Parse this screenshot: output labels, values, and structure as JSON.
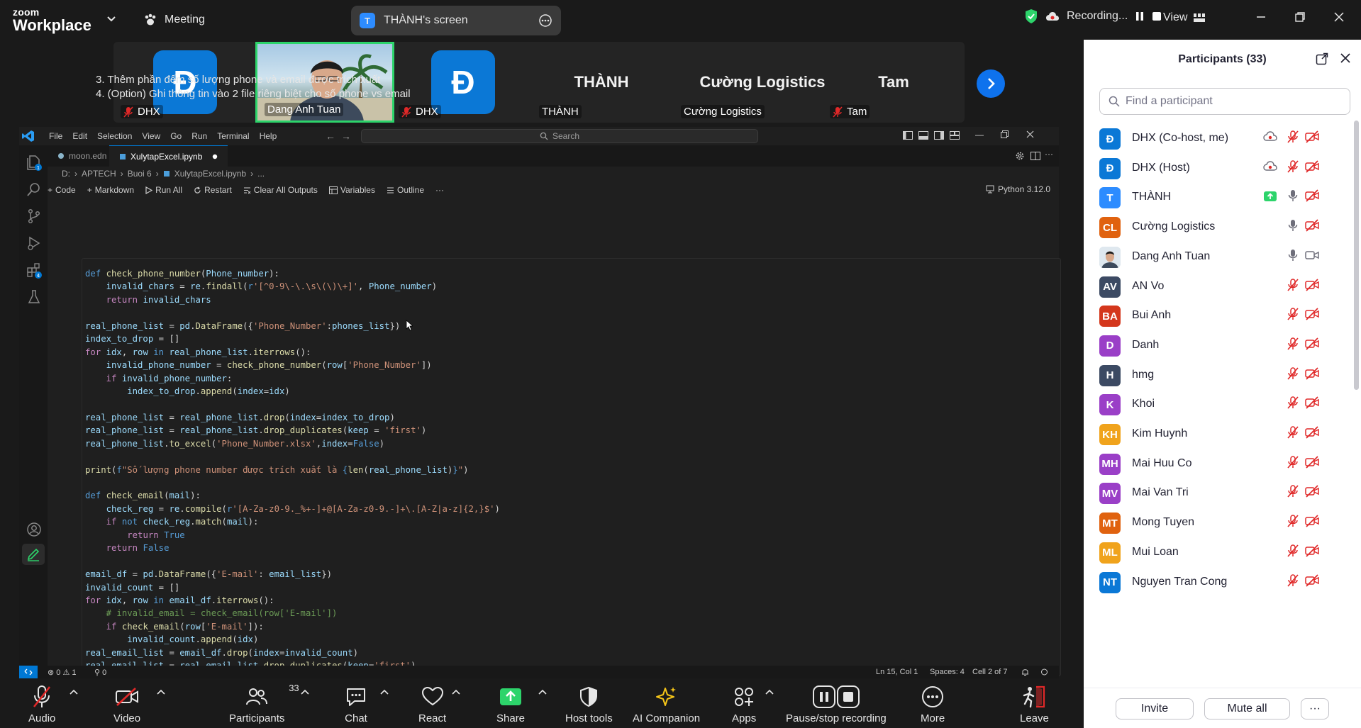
{
  "topbar": {
    "logo_line1": "zoom",
    "logo_line2": "Workplace",
    "meeting_label": "Meeting",
    "screen_badge": "T",
    "screen_label": "THÀNH's screen",
    "recording_label": "Recording...",
    "view_label": "View"
  },
  "gallery": {
    "tiles": [
      {
        "avatar": "Đ",
        "bigname": "",
        "label": "DHX",
        "muted": true
      },
      {
        "avatar": "",
        "bigname": "",
        "label": "Dang Anh Tuan",
        "muted": false,
        "video": true
      },
      {
        "avatar": "Đ",
        "bigname": "",
        "label": "DHX",
        "muted": true
      },
      {
        "avatar": "",
        "bigname": "THÀNH",
        "label": "THÀNH",
        "muted": false
      },
      {
        "avatar": "",
        "bigname": "Cường Logistics",
        "label": "Cường Logistics",
        "muted": false
      },
      {
        "avatar": "",
        "bigname": "Tam",
        "label": "Tam",
        "muted": true
      }
    ]
  },
  "vscode": {
    "menu": [
      "File",
      "Edit",
      "Selection",
      "View",
      "Go",
      "Run",
      "Terminal",
      "Help"
    ],
    "search_placeholder": "Search",
    "tabs": [
      {
        "label": "moon.edn",
        "active": false
      },
      {
        "label": "XulytapExcel.ipynb",
        "active": true
      }
    ],
    "breadcrumb": [
      "D:",
      "APTECH",
      "Buoi 6",
      "XulytapExcel.ipynb",
      "..."
    ],
    "toolbar": {
      "code": "Code",
      "markdown": "Markdown",
      "run_all": "Run All",
      "restart": "Restart",
      "clear": "Clear All Outputs",
      "variables": "Variables",
      "outline": "Outline",
      "more": "···",
      "kernel": "Python 3.12.0"
    },
    "markdown_lines": [
      "3. Thêm phần đếm số lượng phone và email được trích xuất",
      "4. (Option) Ghi thông tin vào 2 file riêng biệt cho số phone vs email"
    ],
    "code_lines": [
      [
        [
          "kw",
          "def "
        ],
        [
          "fn",
          "check_phone_number"
        ],
        [
          "",
          "("
        ],
        [
          "vr",
          "Phone_number"
        ],
        [
          "",
          "):"
        ]
      ],
      [
        [
          "",
          "    "
        ],
        [
          "vr",
          "invalid_chars"
        ],
        [
          "",
          " = "
        ],
        [
          "vr",
          "re"
        ],
        [
          "",
          "."
        ],
        [
          "fn",
          "findall"
        ],
        [
          "",
          "("
        ],
        [
          "kw",
          "r"
        ],
        [
          "st",
          "'[^0-9\\-\\.\\s\\(\\)\\+]'"
        ],
        [
          "",
          ", "
        ],
        [
          "vr",
          "Phone_number"
        ],
        [
          "",
          ")"
        ]
      ],
      [
        [
          "",
          "    "
        ],
        [
          "ct",
          "return "
        ],
        [
          "vr",
          "invalid_chars"
        ]
      ],
      [
        [
          "",
          ""
        ]
      ],
      [
        [
          "vr",
          "real_phone_list"
        ],
        [
          "",
          " = "
        ],
        [
          "vr",
          "pd"
        ],
        [
          "",
          "."
        ],
        [
          "fn",
          "DataFrame"
        ],
        [
          "",
          "({"
        ],
        [
          "st",
          "'Phone_Number'"
        ],
        [
          "",
          ":"
        ],
        [
          "vr",
          "phones_list"
        ],
        [
          "",
          "})"
        ]
      ],
      [
        [
          "vr",
          "index_to_drop"
        ],
        [
          "",
          " = []"
        ]
      ],
      [
        [
          "ct",
          "for "
        ],
        [
          "vr",
          "idx"
        ],
        [
          "",
          ", "
        ],
        [
          "vr",
          "row"
        ],
        [
          "kw",
          " in "
        ],
        [
          "vr",
          "real_phone_list"
        ],
        [
          "",
          "."
        ],
        [
          "fn",
          "iterrows"
        ],
        [
          "",
          "():"
        ]
      ],
      [
        [
          "",
          "    "
        ],
        [
          "vr",
          "invalid_phone_number"
        ],
        [
          "",
          " = "
        ],
        [
          "fn",
          "check_phone_number"
        ],
        [
          "",
          "("
        ],
        [
          "vr",
          "row"
        ],
        [
          "",
          "["
        ],
        [
          "st",
          "'Phone_Number'"
        ],
        [
          "",
          "])"
        ]
      ],
      [
        [
          "",
          "    "
        ],
        [
          "ct",
          "if "
        ],
        [
          "vr",
          "invalid_phone_number"
        ],
        [
          "",
          ":"
        ]
      ],
      [
        [
          "",
          "        "
        ],
        [
          "vr",
          "index_to_drop"
        ],
        [
          "",
          "."
        ],
        [
          "fn",
          "append"
        ],
        [
          "",
          "("
        ],
        [
          "vr",
          "index"
        ],
        [
          "",
          "="
        ],
        [
          "vr",
          "idx"
        ],
        [
          "",
          ")"
        ]
      ],
      [
        [
          "",
          ""
        ]
      ],
      [
        [
          "vr",
          "real_phone_list"
        ],
        [
          "",
          " = "
        ],
        [
          "vr",
          "real_phone_list"
        ],
        [
          "",
          "."
        ],
        [
          "fn",
          "drop"
        ],
        [
          "",
          "("
        ],
        [
          "vr",
          "index"
        ],
        [
          "",
          "="
        ],
        [
          "vr",
          "index_to_drop"
        ],
        [
          "",
          ")"
        ]
      ],
      [
        [
          "vr",
          "real_phone_list"
        ],
        [
          "",
          " = "
        ],
        [
          "vr",
          "real_phone_list"
        ],
        [
          "",
          "."
        ],
        [
          "fn",
          "drop_duplicates"
        ],
        [
          "",
          "("
        ],
        [
          "vr",
          "keep"
        ],
        [
          "",
          " = "
        ],
        [
          "st",
          "'first'"
        ],
        [
          "",
          ")"
        ]
      ],
      [
        [
          "vr",
          "real_phone_list"
        ],
        [
          "",
          "."
        ],
        [
          "fn",
          "to_excel"
        ],
        [
          "",
          "("
        ],
        [
          "st",
          "'Phone_Number.xlsx'"
        ],
        [
          "",
          ","
        ],
        [
          "vr",
          "index"
        ],
        [
          "",
          "="
        ],
        [
          "kw",
          "False"
        ],
        [
          "",
          ")"
        ]
      ],
      [
        [
          "",
          ""
        ]
      ],
      [
        [
          "fn",
          "print"
        ],
        [
          "",
          "("
        ],
        [
          "kw",
          "f"
        ],
        [
          "st",
          "\"Số lượng phone number được trích xuất là "
        ],
        [
          "kw",
          "{"
        ],
        [
          "fn",
          "len"
        ],
        [
          "",
          "("
        ],
        [
          "vr",
          "real_phone_list"
        ],
        [
          "",
          ")"
        ],
        [
          "kw",
          "}"
        ],
        [
          "st",
          "\""
        ],
        [
          "",
          ")"
        ]
      ],
      [
        [
          "",
          ""
        ]
      ],
      [
        [
          "kw",
          "def "
        ],
        [
          "fn",
          "check_email"
        ],
        [
          "",
          "("
        ],
        [
          "vr",
          "mail"
        ],
        [
          "",
          "):"
        ]
      ],
      [
        [
          "",
          "    "
        ],
        [
          "vr",
          "check_reg"
        ],
        [
          "",
          " = "
        ],
        [
          "vr",
          "re"
        ],
        [
          "",
          "."
        ],
        [
          "fn",
          "compile"
        ],
        [
          "",
          "("
        ],
        [
          "kw",
          "r"
        ],
        [
          "st",
          "'[A-Za-z0-9._%+-]+@[A-Za-z0-9.-]+\\.[A-Z|a-z]{2,}$'"
        ],
        [
          "",
          ")"
        ]
      ],
      [
        [
          "",
          "    "
        ],
        [
          "ct",
          "if "
        ],
        [
          "kw",
          "not "
        ],
        [
          "vr",
          "check_reg"
        ],
        [
          "",
          "."
        ],
        [
          "fn",
          "match"
        ],
        [
          "",
          "("
        ],
        [
          "vr",
          "mail"
        ],
        [
          "",
          "):"
        ]
      ],
      [
        [
          "",
          "        "
        ],
        [
          "ct",
          "return "
        ],
        [
          "kw",
          "True"
        ]
      ],
      [
        [
          "",
          "    "
        ],
        [
          "ct",
          "return "
        ],
        [
          "kw",
          "False"
        ]
      ],
      [
        [
          "",
          ""
        ]
      ],
      [
        [
          "vr",
          "email_df"
        ],
        [
          "",
          " = "
        ],
        [
          "vr",
          "pd"
        ],
        [
          "",
          "."
        ],
        [
          "fn",
          "DataFrame"
        ],
        [
          "",
          "({"
        ],
        [
          "st",
          "'E-mail'"
        ],
        [
          "",
          ": "
        ],
        [
          "vr",
          "email_list"
        ],
        [
          "",
          "})"
        ]
      ],
      [
        [
          "vr",
          "invalid_count"
        ],
        [
          "",
          " = []"
        ]
      ],
      [
        [
          "ct",
          "for "
        ],
        [
          "vr",
          "idx"
        ],
        [
          "",
          ", "
        ],
        [
          "vr",
          "row"
        ],
        [
          "kw",
          " in "
        ],
        [
          "vr",
          "email_df"
        ],
        [
          "",
          "."
        ],
        [
          "fn",
          "iterrows"
        ],
        [
          "",
          "():"
        ]
      ],
      [
        [
          "",
          "    "
        ],
        [
          "cm",
          "# invalid_email = check_email(row['E-mail'])"
        ]
      ],
      [
        [
          "",
          "    "
        ],
        [
          "ct",
          "if "
        ],
        [
          "fn",
          "check_email"
        ],
        [
          "",
          "("
        ],
        [
          "vr",
          "row"
        ],
        [
          "",
          "["
        ],
        [
          "st",
          "'E-mail'"
        ],
        [
          "",
          "]):"
        ]
      ],
      [
        [
          "",
          "        "
        ],
        [
          "vr",
          "invalid_count"
        ],
        [
          "",
          "."
        ],
        [
          "fn",
          "append"
        ],
        [
          "",
          "("
        ],
        [
          "vr",
          "idx"
        ],
        [
          "",
          ")"
        ]
      ],
      [
        [
          "vr",
          "real_email_list"
        ],
        [
          "",
          " = "
        ],
        [
          "vr",
          "email_df"
        ],
        [
          "",
          "."
        ],
        [
          "fn",
          "drop"
        ],
        [
          "",
          "("
        ],
        [
          "vr",
          "index"
        ],
        [
          "",
          "="
        ],
        [
          "vr",
          "invalid_count"
        ],
        [
          "",
          ")"
        ]
      ],
      [
        [
          "vr",
          "real_email_list"
        ],
        [
          "",
          " = "
        ],
        [
          "vr",
          "real_email_list"
        ],
        [
          "",
          "."
        ],
        [
          "fn",
          "drop_duplicates"
        ],
        [
          "",
          "("
        ],
        [
          "vr",
          "keep"
        ],
        [
          "",
          "="
        ],
        [
          "st",
          "'first'"
        ],
        [
          "",
          ")"
        ]
      ]
    ],
    "status": {
      "problems": "⊗ 0 ⚠ 1",
      "ports": "⚲ 0",
      "position": "Ln 15, Col 1",
      "spaces": "Spaces: 4",
      "cell": "Cell 2 of 7"
    }
  },
  "participants": {
    "title": "Participants (33)",
    "search_placeholder": "Find a participant",
    "list": [
      {
        "initials": "Đ",
        "name": "DHX (Co-host, me)",
        "color": "#0b78d6",
        "cloud": true,
        "share": false,
        "mic": "muted",
        "cam": "off"
      },
      {
        "initials": "Đ",
        "name": "DHX (Host)",
        "color": "#0b78d6",
        "cloud": true,
        "share": false,
        "mic": "muted",
        "cam": "off"
      },
      {
        "initials": "T",
        "name": "THÀNH",
        "color": "#2d8cff",
        "cloud": false,
        "share": true,
        "mic": "on",
        "cam": "off"
      },
      {
        "initials": "CL",
        "name": "Cường Logistics",
        "color": "#e0620f",
        "cloud": false,
        "share": false,
        "mic": "on",
        "cam": "off"
      },
      {
        "initials": "",
        "name": "Dang Anh Tuan",
        "color": "#c9d7e3",
        "photo": true,
        "cloud": false,
        "share": false,
        "mic": "on",
        "cam": "on"
      },
      {
        "initials": "AV",
        "name": "AN Vo",
        "color": "#3c4a63",
        "cloud": false,
        "share": false,
        "mic": "muted",
        "cam": "off"
      },
      {
        "initials": "BA",
        "name": "Bui Anh",
        "color": "#d4371c",
        "cloud": false,
        "share": false,
        "mic": "muted",
        "cam": "off"
      },
      {
        "initials": "D",
        "name": "Danh",
        "color": "#9a3fc7",
        "cloud": false,
        "share": false,
        "mic": "muted",
        "cam": "off"
      },
      {
        "initials": "H",
        "name": "hmg",
        "color": "#3c4a63",
        "cloud": false,
        "share": false,
        "mic": "muted",
        "cam": "off"
      },
      {
        "initials": "K",
        "name": "Khoi",
        "color": "#9a3fc7",
        "cloud": false,
        "share": false,
        "mic": "muted",
        "cam": "off"
      },
      {
        "initials": "KH",
        "name": "Kim Huynh",
        "color": "#f0a31c",
        "cloud": false,
        "share": false,
        "mic": "muted",
        "cam": "off"
      },
      {
        "initials": "MH",
        "name": "Mai Huu Co",
        "color": "#9a3fc7",
        "cloud": false,
        "share": false,
        "mic": "muted",
        "cam": "off"
      },
      {
        "initials": "MV",
        "name": "Mai Van Tri",
        "color": "#9a3fc7",
        "cloud": false,
        "share": false,
        "mic": "muted",
        "cam": "off"
      },
      {
        "initials": "MT",
        "name": "Mong Tuyen",
        "color": "#e0620f",
        "cloud": false,
        "share": false,
        "mic": "muted",
        "cam": "off"
      },
      {
        "initials": "ML",
        "name": "Mui Loan",
        "color": "#f0a31c",
        "cloud": false,
        "share": false,
        "mic": "muted",
        "cam": "off"
      },
      {
        "initials": "NT",
        "name": "Nguyen Tran Cong",
        "color": "#0b78d6",
        "cloud": false,
        "share": false,
        "mic": "muted",
        "cam": "off"
      }
    ],
    "invite_label": "Invite",
    "mute_all_label": "Mute all",
    "more_label": "···"
  },
  "toolbar": {
    "audio": "Audio",
    "video": "Video",
    "participants": "Participants",
    "participants_count": "33",
    "chat": "Chat",
    "react": "React",
    "share": "Share",
    "host_tools": "Host tools",
    "ai_companion": "AI Companion",
    "apps": "Apps",
    "pause_recording": "Pause/stop recording",
    "more": "More",
    "leave": "Leave"
  },
  "colors": {
    "zoom_blue": "#0e72ed",
    "share_green": "#2dd46b",
    "muted_red": "#e02828",
    "leave_red": "#e02828"
  }
}
